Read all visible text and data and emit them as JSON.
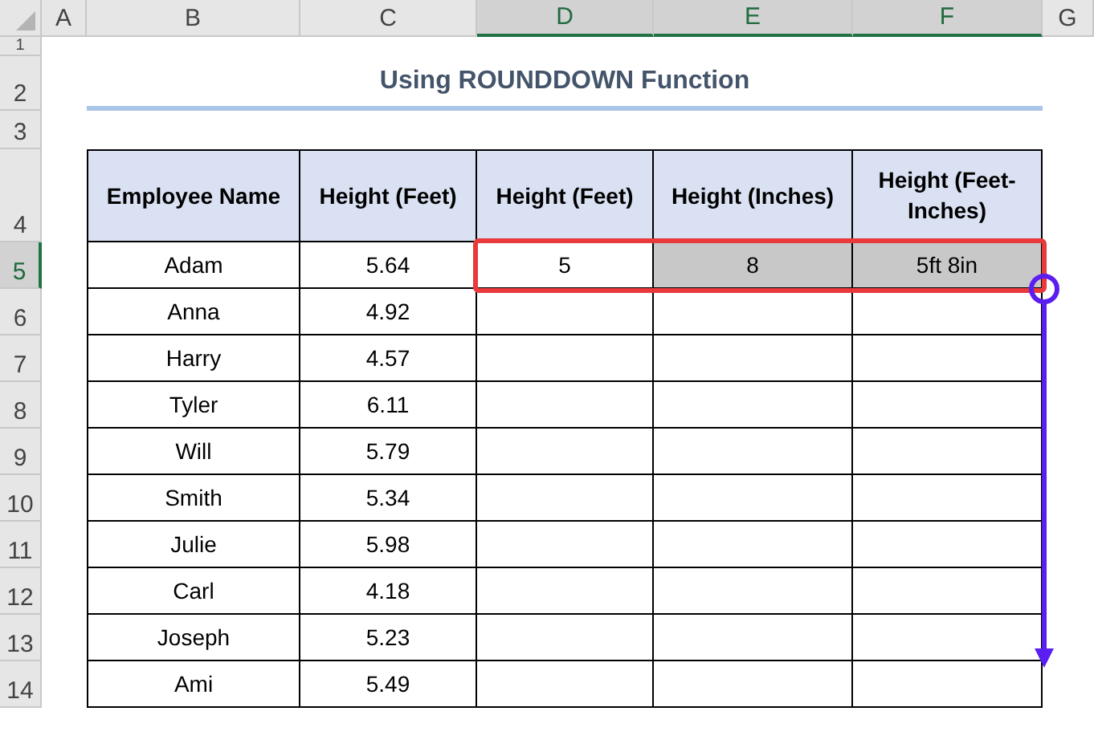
{
  "column_headers": [
    {
      "label": "A",
      "selected": false
    },
    {
      "label": "B",
      "selected": false
    },
    {
      "label": "C",
      "selected": false
    },
    {
      "label": "D",
      "selected": true
    },
    {
      "label": "E",
      "selected": true
    },
    {
      "label": "F",
      "selected": true
    },
    {
      "label": "G",
      "selected": false
    }
  ],
  "row_headers": [
    {
      "label": "1",
      "selected": false
    },
    {
      "label": "2",
      "selected": false
    },
    {
      "label": "3",
      "selected": false
    },
    {
      "label": "4",
      "selected": false
    },
    {
      "label": "5",
      "selected": true
    },
    {
      "label": "6",
      "selected": false
    },
    {
      "label": "7",
      "selected": false
    },
    {
      "label": "8",
      "selected": false
    },
    {
      "label": "9",
      "selected": false
    },
    {
      "label": "10",
      "selected": false
    },
    {
      "label": "11",
      "selected": false
    },
    {
      "label": "12",
      "selected": false
    },
    {
      "label": "13",
      "selected": false
    },
    {
      "label": "14",
      "selected": false
    }
  ],
  "title": "Using ROUNDDOWN Function",
  "table": {
    "columns": [
      "Employee Name",
      "Height (Feet)",
      "Height (Feet)",
      "Height (Inches)",
      "Height (Feet-Inches)"
    ],
    "rows": [
      {
        "cells": [
          {
            "text": "Adam",
            "selected": false
          },
          {
            "text": "5.64",
            "selected": false
          },
          {
            "text": "5",
            "selected": false
          },
          {
            "text": "8",
            "selected": true
          },
          {
            "text": "5ft 8in",
            "selected": true
          }
        ]
      },
      {
        "cells": [
          {
            "text": "Anna",
            "selected": false
          },
          {
            "text": "4.92",
            "selected": false
          }
        ]
      },
      {
        "cells": [
          {
            "text": "Harry",
            "selected": false
          },
          {
            "text": "4.57",
            "selected": false
          }
        ]
      },
      {
        "cells": [
          {
            "text": "Tyler",
            "selected": false
          },
          {
            "text": "6.11",
            "selected": false
          }
        ]
      },
      {
        "cells": [
          {
            "text": "Will",
            "selected": false
          },
          {
            "text": "5.79",
            "selected": false
          }
        ]
      },
      {
        "cells": [
          {
            "text": "Smith",
            "selected": false
          },
          {
            "text": "5.34",
            "selected": false
          }
        ]
      },
      {
        "cells": [
          {
            "text": "Julie",
            "selected": false
          },
          {
            "text": "5.98",
            "selected": false
          }
        ]
      },
      {
        "cells": [
          {
            "text": "Carl",
            "selected": false
          },
          {
            "text": "4.18",
            "selected": false
          }
        ]
      },
      {
        "cells": [
          {
            "text": "Joseph",
            "selected": false
          },
          {
            "text": "5.23",
            "selected": false
          }
        ]
      },
      {
        "cells": [
          {
            "text": "Ami",
            "selected": false
          },
          {
            "text": "5.49",
            "selected": false
          }
        ]
      }
    ]
  }
}
